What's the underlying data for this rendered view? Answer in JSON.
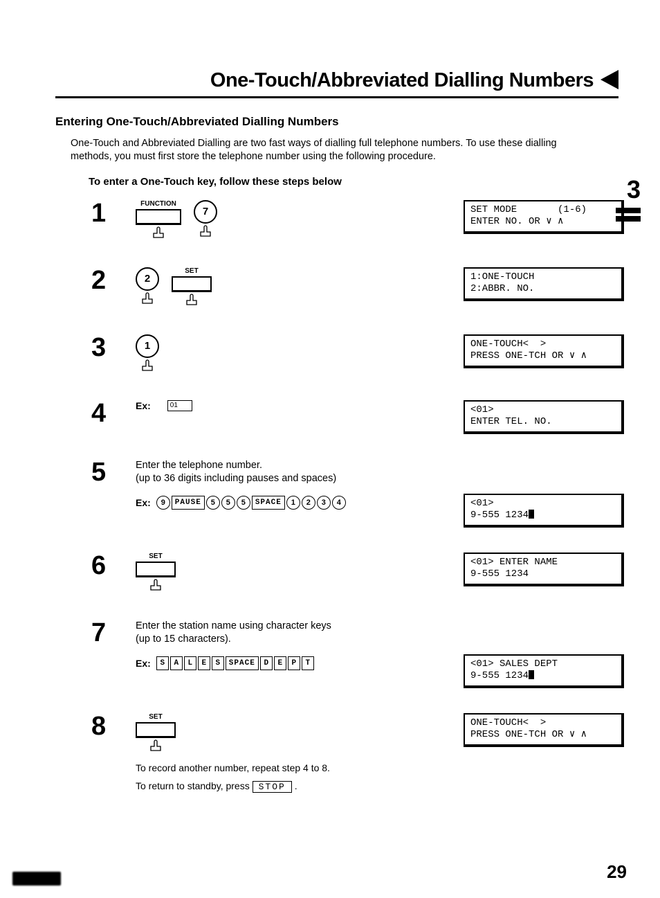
{
  "title": "One-Touch/Abbreviated Dialling Numbers",
  "subheading": "Entering One-Touch/Abbreviated Dialling Numbers",
  "intro": "One-Touch and Abbreviated Dialling are two fast ways of dialling full telephone numbers. To use these dialling methods, you must first store the telephone number using the following procedure.",
  "instruction": "To enter a One-Touch key, follow these steps below",
  "chapter_number": "3",
  "page_number": "29",
  "keys": {
    "function": "FUNCTION",
    "set": "SET",
    "seven": "7",
    "two": "2",
    "one": "1",
    "stop": "STOP",
    "pause": "PAUSE",
    "space": "SPACE"
  },
  "steps": {
    "s1": {
      "num": "1",
      "lcd": "SET MODE       (1-6)\nENTER NO. OR ∨ ∧"
    },
    "s2": {
      "num": "2",
      "lcd": "1:ONE-TOUCH\n2:ABBR. NO."
    },
    "s3": {
      "num": "3",
      "lcd": "ONE-TOUCH<  >\nPRESS ONE-TCH OR ∨ ∧"
    },
    "s4": {
      "num": "4",
      "ex_label": "Ex:",
      "ex_value": "01",
      "lcd": "<01>\nENTER TEL. NO."
    },
    "s5": {
      "num": "5",
      "text1": "Enter the telephone number.",
      "text2": "(up to 36 digits including pauses and spaces)",
      "ex_label": "Ex:",
      "seq": [
        "9",
        "PAUSE",
        "5",
        "5",
        "5",
        "SPACE",
        "1",
        "2",
        "3",
        "4"
      ],
      "lcd": "<01>\n9-555 1234"
    },
    "s6": {
      "num": "6",
      "lcd": "<01> ENTER NAME\n9-555 1234"
    },
    "s7": {
      "num": "7",
      "text1": "Enter the station name using character keys",
      "text2": "(up to 15 characters).",
      "ex_label": "Ex:",
      "seq": [
        "S",
        "A",
        "L",
        "E",
        "S",
        "SPACE",
        "D",
        "E",
        "P",
        "T"
      ],
      "lcd": "<01> SALES DEPT\n9-555 1234"
    },
    "s8": {
      "num": "8",
      "lcd": "ONE-TOUCH<  >\nPRESS ONE-TCH OR ∨ ∧",
      "note1": "To record another number, repeat step 4 to 8.",
      "note2a": "To return to standby, press ",
      "note2b": "."
    }
  }
}
